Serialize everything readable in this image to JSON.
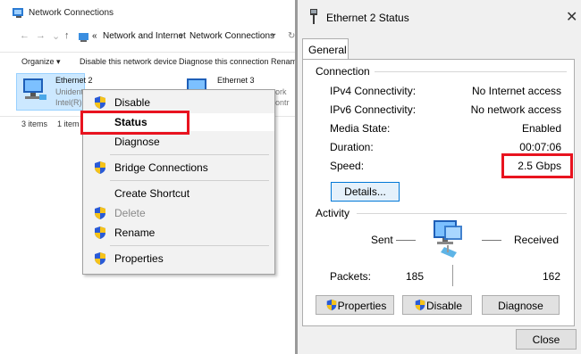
{
  "explorer": {
    "title": "Network Connections",
    "address": {
      "prefix": "«",
      "crumb1": "Network and Internet",
      "sep": "›",
      "crumb2": "Network Connections",
      "dropdown": "⌄",
      "refresh": "↻"
    },
    "commands": {
      "organize": "Organize ▾",
      "disable": "Disable this network device",
      "diagnose": "Diagnose this connection",
      "rename": "Renam"
    },
    "adapters": [
      {
        "name": "Ethernet 2",
        "line2": "Unident",
        "line3": "Intel(R)"
      },
      {
        "name": "Ethernet 3",
        "line2": "ork",
        "line3": "ontr"
      }
    ],
    "status": {
      "items": "3 items",
      "selected": "1 item"
    }
  },
  "context_menu": {
    "items": [
      {
        "label": "Disable",
        "icon": "shield-icon",
        "disabled": false
      },
      {
        "label": "Status",
        "icon": "",
        "disabled": false
      },
      {
        "label": "Diagnose",
        "icon": "",
        "disabled": false
      },
      {
        "label": "Bridge Connections",
        "icon": "shield-icon",
        "disabled": false
      },
      {
        "label": "Create Shortcut",
        "icon": "",
        "disabled": false
      },
      {
        "label": "Delete",
        "icon": "shield-icon",
        "disabled": true
      },
      {
        "label": "Rename",
        "icon": "shield-icon",
        "disabled": false
      },
      {
        "label": "Properties",
        "icon": "shield-icon",
        "disabled": false
      }
    ]
  },
  "dialog": {
    "title": "Ethernet 2 Status",
    "close": "✕",
    "tab": "General",
    "connection": {
      "label": "Connection",
      "rows": [
        {
          "label": "IPv4 Connectivity:",
          "value": "No Internet access"
        },
        {
          "label": "IPv6 Connectivity:",
          "value": "No network access"
        },
        {
          "label": "Media State:",
          "value": "Enabled"
        },
        {
          "label": "Duration:",
          "value": "00:07:06"
        },
        {
          "label": "Speed:",
          "value": "2.5 Gbps"
        }
      ],
      "details_button": "Details..."
    },
    "activity": {
      "label": "Activity",
      "sent": "Sent",
      "received": "Received",
      "packets_label": "Packets:",
      "packets_sent": "185",
      "packets_received": "162"
    },
    "buttons": {
      "properties": "Properties",
      "disable": "Disable",
      "diagnose": "Diagnose",
      "close": "Close"
    }
  },
  "colors": {
    "highlight_red": "#e8131f",
    "selection_blue": "#cce8ff"
  }
}
